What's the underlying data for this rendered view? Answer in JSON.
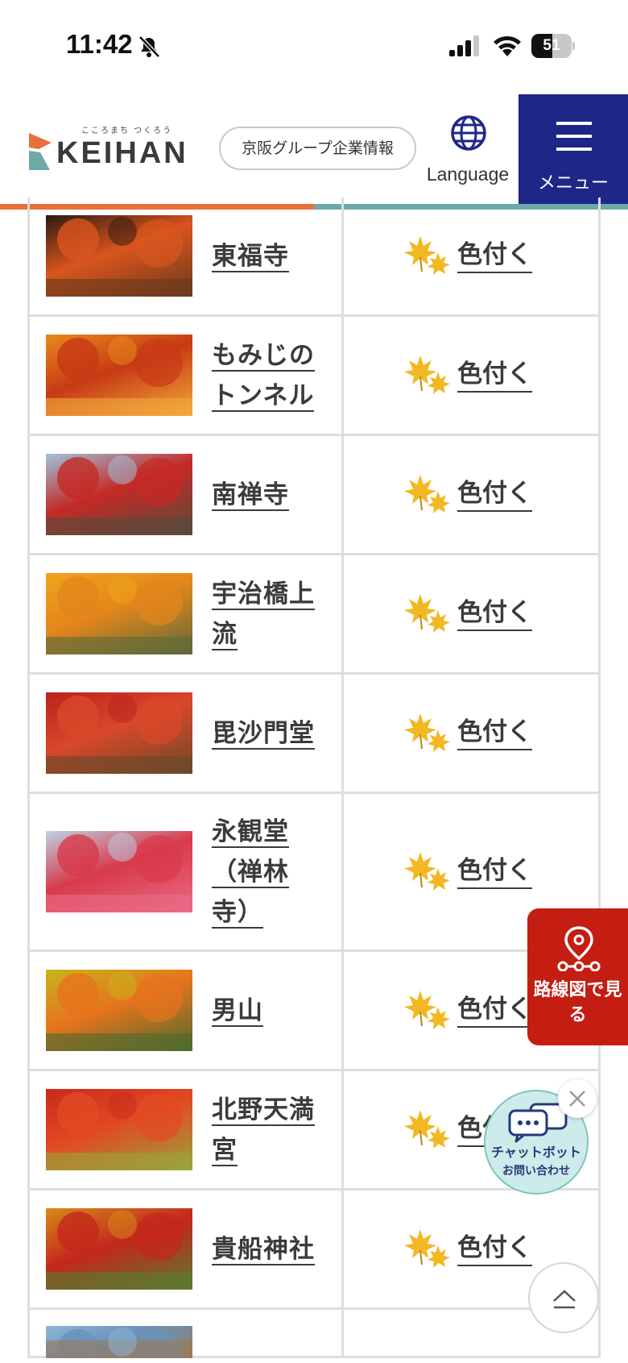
{
  "status_bar": {
    "time": "11:42",
    "battery": "51",
    "battery_level": 0.51
  },
  "header": {
    "logo_tagline": "こころまち つくろう",
    "logo_word": "KEIHAN",
    "group_button": "京阪グループ企業情報",
    "language_label": "Language",
    "menu_label": "メニュー"
  },
  "spots": [
    {
      "name": "東福寺",
      "status": "色付く",
      "lines": 1,
      "height": 148,
      "colors": [
        "#2b1a12",
        "#d9551e",
        "#6b3a1c"
      ]
    },
    {
      "name": "もみじのトンネル",
      "status": "色付く",
      "lines": 2,
      "height": 148,
      "colors": [
        "#e88a1c",
        "#c73a15",
        "#f2a93b"
      ]
    },
    {
      "name": "南禅寺",
      "status": "色付く",
      "lines": 1,
      "height": 148,
      "colors": [
        "#9fc3dd",
        "#c42a26",
        "#5a4a3a"
      ]
    },
    {
      "name": "宇治橋上流",
      "status": "色付く",
      "lines": 2,
      "height": 148,
      "colors": [
        "#f0a41c",
        "#e3861b",
        "#5f6a3a"
      ]
    },
    {
      "name": "毘沙門堂",
      "status": "色付く",
      "lines": 1,
      "height": 148,
      "colors": [
        "#b8231d",
        "#d8482a",
        "#6b4a2a"
      ]
    },
    {
      "name": "永観堂（禅林寺）",
      "status": "色付く",
      "lines": 3,
      "height": 196,
      "colors": [
        "#bcd2e6",
        "#d83a4a",
        "#e96a86"
      ]
    },
    {
      "name": "男山",
      "status": "色付く",
      "lines": 1,
      "height": 148,
      "colors": [
        "#c8b41c",
        "#e6741d",
        "#4f6a2e"
      ]
    },
    {
      "name": "北野天満宮",
      "status": "色付く",
      "lines": 2,
      "height": 148,
      "colors": [
        "#c82a1c",
        "#e14a23",
        "#9aa33a"
      ]
    },
    {
      "name": "貴船神社",
      "status": "色付く",
      "lines": 1,
      "height": 148,
      "colors": [
        "#d68b1a",
        "#c4271c",
        "#5a7a2e"
      ]
    },
    {
      "name": "",
      "status": "",
      "lines": 1,
      "height": 60,
      "colors": [
        "#8fb6d8",
        "#6a92b8",
        "#9a7a5a"
      ]
    }
  ],
  "floating": {
    "route_label": "路線図で見る",
    "chat_label": "チャットボット",
    "chat_sub": "お問い合わせ"
  },
  "colors": {
    "accent_orange": "#e9703a",
    "accent_teal": "#6ea8a8",
    "menu_navy": "#1e2688",
    "route_red": "#c41e12",
    "leaf_yellow": "#f2b824"
  }
}
